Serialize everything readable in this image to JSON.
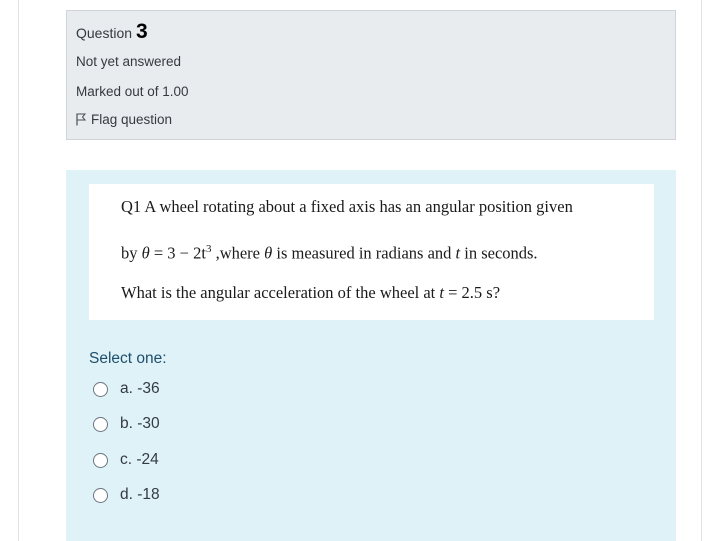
{
  "info": {
    "question_label": "Question",
    "question_number": "3",
    "state": "Not yet answered",
    "grade": "Marked out of 1.00",
    "flag_label": "Flag question"
  },
  "question": {
    "line1": "Q1 A wheel rotating about a fixed axis has an angular position given",
    "line2_prefix": "by ",
    "line2_theta1": "θ",
    "line2_eq": " = 3 − 2t",
    "line2_exp": "3",
    "line2_mid": " ,where  ",
    "line2_theta2": "θ",
    "line2_suffix": " is measured in radians and ",
    "line2_t": "t",
    "line2_end": " in seconds.",
    "line3_prefix": "What is the angular  acceleration  of the wheel at ",
    "line3_t": "t",
    "line3_end": " = 2.5  s?"
  },
  "select_label": "Select one:",
  "options": [
    {
      "label": "a. -36"
    },
    {
      "label": "b. -30"
    },
    {
      "label": "c. -24"
    },
    {
      "label": "d. -18"
    }
  ]
}
